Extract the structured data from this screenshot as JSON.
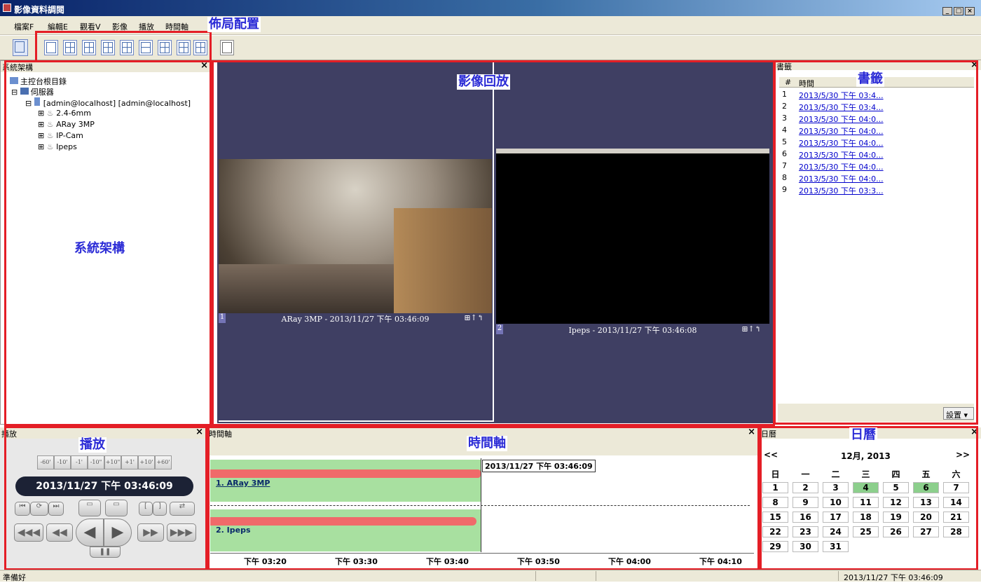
{
  "window": {
    "title": "影像資料調閱",
    "buttons": {
      "minimize": "_",
      "maximize": "□",
      "close": "×"
    }
  },
  "menu": [
    "檔案F",
    "編輯E",
    "觀看V",
    "影像",
    "播放",
    "時間軸"
  ],
  "annotations": {
    "layout": "佈局配置",
    "system": "系統架構",
    "playback_area": "影像回放",
    "bookmarks": "書籤",
    "play": "播放",
    "timeline": "時間軸",
    "calendar": "日曆"
  },
  "system_panel": {
    "title": "系統架構",
    "tree": [
      {
        "label": "主控台根目錄",
        "icon": "console-icon"
      },
      {
        "label": "伺服器",
        "icon": "server-icon"
      },
      {
        "label": "[admin@localhost] [admin@localhost]",
        "icon": "host-icon"
      },
      {
        "label": "2.4-6mm",
        "icon": "camera-icon"
      },
      {
        "label": "ARay 3MP",
        "icon": "camera-icon"
      },
      {
        "label": "IP-Cam",
        "icon": "camera-icon"
      },
      {
        "label": "Ipeps",
        "icon": "camera-icon"
      }
    ]
  },
  "videos": [
    {
      "num": "1",
      "caption": "ARay 3MP - 2013/11/27 下午 03:46:09"
    },
    {
      "num": "2",
      "caption": "Ipeps - 2013/11/27 下午 03:46:08"
    }
  ],
  "bookmarks": {
    "title": "書籤",
    "columns": [
      "#",
      "時間"
    ],
    "rows": [
      {
        "n": "1",
        "t": "2013/5/30 下午 03:4..."
      },
      {
        "n": "2",
        "t": "2013/5/30 下午 03:4..."
      },
      {
        "n": "3",
        "t": "2013/5/30 下午 04:0..."
      },
      {
        "n": "4",
        "t": "2013/5/30 下午 04:0..."
      },
      {
        "n": "5",
        "t": "2013/5/30 下午 04:0..."
      },
      {
        "n": "6",
        "t": "2013/5/30 下午 04:0..."
      },
      {
        "n": "7",
        "t": "2013/5/30 下午 04:0..."
      },
      {
        "n": "8",
        "t": "2013/5/30 下午 04:0..."
      },
      {
        "n": "9",
        "t": "2013/5/30 下午 03:3..."
      }
    ],
    "settings": "設置"
  },
  "playback": {
    "title": "播放",
    "seek": [
      "-60'",
      "-10'",
      "-1'",
      "-10\"",
      "+10\"",
      "+1'",
      "+10'",
      "+60'"
    ],
    "datetime": "2013/11/27 下午 03:46:09"
  },
  "timeline": {
    "title": "時間軸",
    "cursor_time": "2013/11/27 下午 03:46:09",
    "tracks": [
      "1. ARay 3MP",
      "2. Ipeps"
    ],
    "ticks": [
      "下午 03:20",
      "下午 03:30",
      "下午 03:40",
      "下午 03:50",
      "下午 04:00",
      "下午 04:10"
    ]
  },
  "calendar": {
    "title": "日曆",
    "prev": "<<",
    "next": ">>",
    "month": "12月, 2013",
    "weekdays": [
      "日",
      "一",
      "二",
      "三",
      "四",
      "五",
      "六"
    ],
    "highlight_days": [
      "4",
      "6"
    ],
    "weeks": [
      [
        "1",
        "2",
        "3",
        "4",
        "5",
        "6",
        "7"
      ],
      [
        "8",
        "9",
        "10",
        "11",
        "12",
        "13",
        "14"
      ],
      [
        "15",
        "16",
        "17",
        "18",
        "19",
        "20",
        "21"
      ],
      [
        "22",
        "23",
        "24",
        "25",
        "26",
        "27",
        "28"
      ],
      [
        "29",
        "30",
        "31"
      ]
    ]
  },
  "status": {
    "left": "準備好",
    "right": "2013/11/27 下午 03:46:09"
  },
  "colors": {
    "annotation": "#2b2bd6",
    "highlight_box": "#e41e26",
    "video_bg": "#3f3f63",
    "timeline_green": "#a8e0a0",
    "timeline_red": "#f06a6a",
    "calendar_highlight": "#8ccf8c"
  }
}
